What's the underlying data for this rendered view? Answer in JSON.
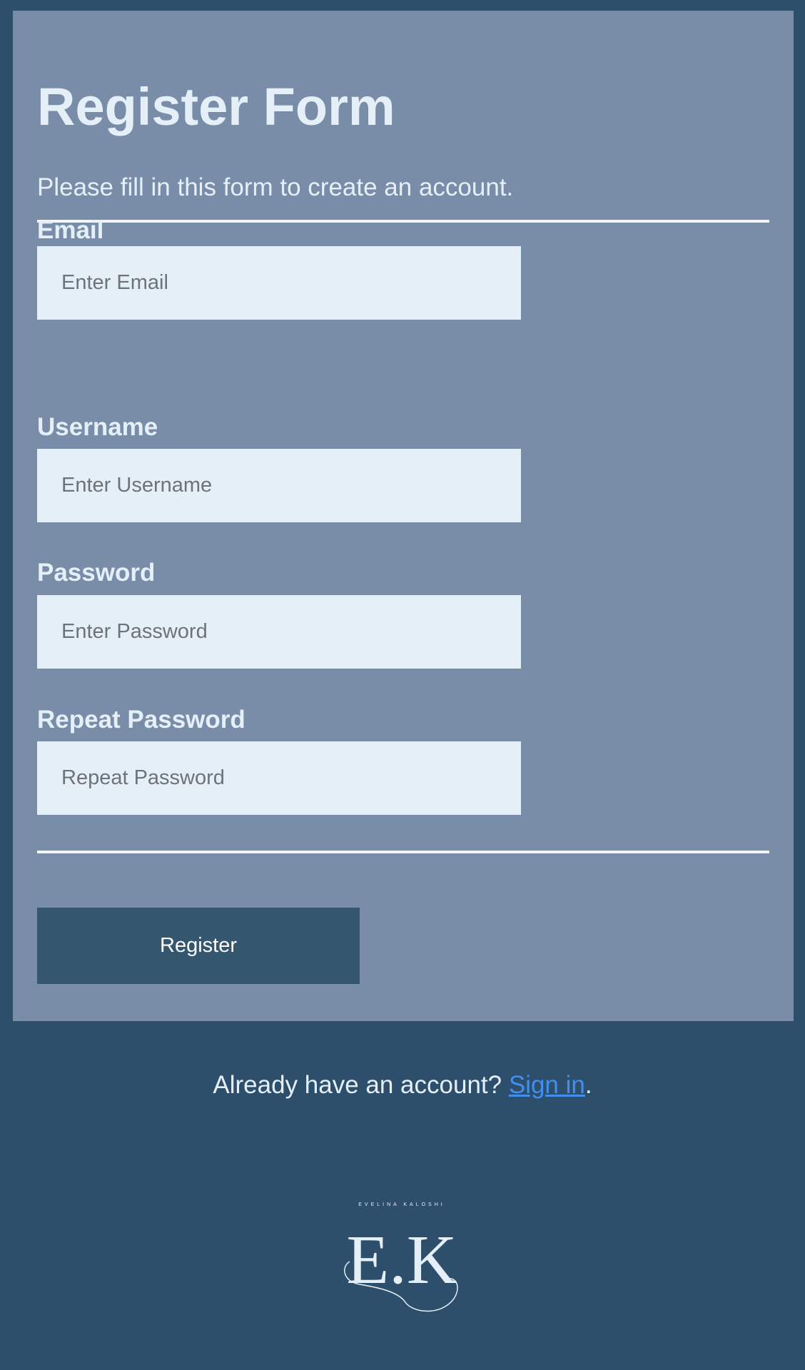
{
  "form": {
    "title": "Register Form",
    "subtitle": "Please fill in this form to create an account.",
    "fields": [
      {
        "label": "Email",
        "placeholder": "Enter Email",
        "value": ""
      },
      {
        "label": "Username",
        "placeholder": "Enter Username",
        "value": ""
      },
      {
        "label": "Password",
        "placeholder": "Enter Password",
        "value": ""
      },
      {
        "label": "Repeat Password",
        "placeholder": "Repeat Password",
        "value": ""
      }
    ],
    "submit_label": "Register"
  },
  "footer": {
    "signin_prefix": "Already have an account? ",
    "signin_link": "Sign in",
    "signin_suffix": ".",
    "logo_caption": "EVELINA KALOSHI",
    "logo_mark": "E.K"
  },
  "colors": {
    "page_background": "#2d4f6c",
    "form_background": "#7a8da8",
    "input_background": "#e4eff8",
    "button_background": "#34566f",
    "link": "#3f8ef0"
  }
}
